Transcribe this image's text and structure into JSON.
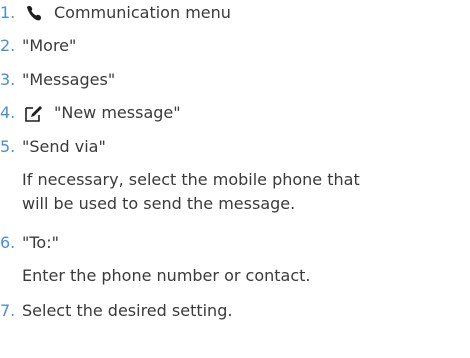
{
  "steps": [
    {
      "number": "1.",
      "text": "Communication menu",
      "icon": "phone-icon"
    },
    {
      "number": "2.",
      "text": "\"More\""
    },
    {
      "number": "3.",
      "text": "\"Messages\""
    },
    {
      "number": "4.",
      "text": "\"New message\"",
      "icon": "compose-icon"
    },
    {
      "number": "5.",
      "text": "\"Send via\""
    },
    {
      "number": "6.",
      "text": "\"To:\""
    },
    {
      "number": "7.",
      "text": "Select the desired setting."
    }
  ],
  "notes": {
    "step5_line1": "If necessary, select the mobile phone that",
    "step5_line2": "will be used to send the message.",
    "step6": "Enter the phone number or contact."
  },
  "colors": {
    "number": "#4a90cf",
    "text": "#3a3a3a"
  }
}
